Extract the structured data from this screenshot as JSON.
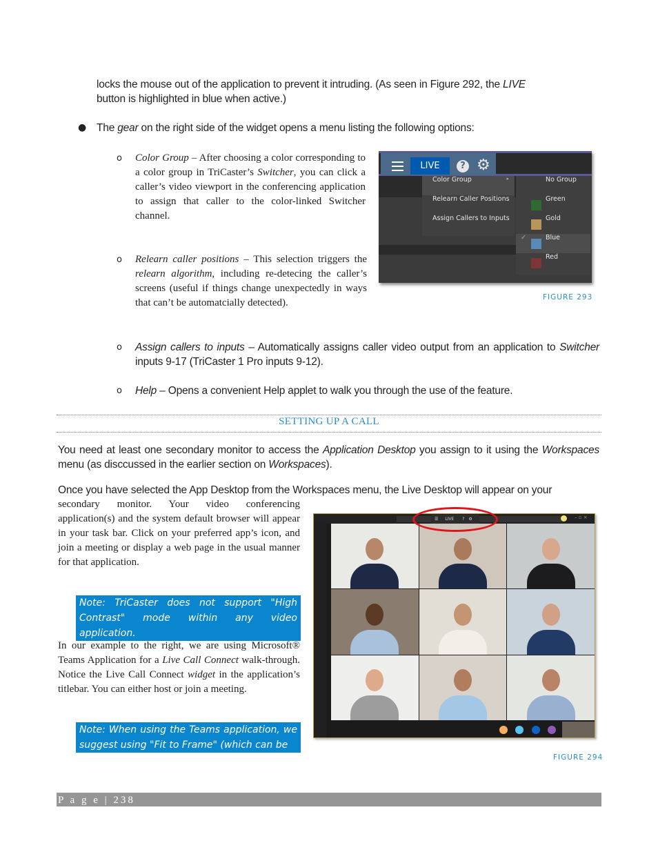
{
  "intro": {
    "line1": "locks the mouse out of the application to prevent it intruding.  (As seen in Figure 292, the ",
    "live_word": "LIVE",
    "line2": "button is highlighted in blue when active.)"
  },
  "gear_bullet": {
    "prefix": "The ",
    "gear_word": "gear",
    "rest": " on the right side of the widget opens a menu listing the following options:"
  },
  "options": [
    {
      "term": "Color Group",
      "text_a": " – After choosing a color corresponding to a color group in TriCaster’s ",
      "switcher": "Switcher",
      "text_b": ", you can click a caller’s video viewport in the conferencing application to assign that caller to the color-linked Switcher channel."
    },
    {
      "term": "Relearn caller positions",
      "text_a": " – This selection triggers the ",
      "algo": "relearn algorithm",
      "text_b": ", including re-detecing the caller’s screens (useful if things change unexpectedly in ways that can’t be automatcially detected)."
    },
    {
      "term": "Assign callers to inputs",
      "text_a": " – Automatically assigns caller video output from an application to ",
      "switcher": "Switcher",
      "text_b": " inputs 9-17 (TriCaster 1 Pro inputs 9-12)."
    },
    {
      "term": "Help",
      "text_a": " – Opens a convenient Help applet to walk you through the use of the feature."
    }
  ],
  "figure293": {
    "caption": "FIGURE 293",
    "live_label": "LIVE",
    "help_glyph": "?",
    "gear_glyph": "⚙",
    "menu_items": [
      "Color Group",
      "Relearn Caller Positions",
      "Assign Callers to Inputs"
    ],
    "submenu_arrow": "▸",
    "color_groups": [
      {
        "label": "No Group",
        "color": null,
        "checked": false
      },
      {
        "label": "Green",
        "color": "#2f6b30",
        "checked": false
      },
      {
        "label": "Gold",
        "color": "#b8965a",
        "checked": false
      },
      {
        "label": "Blue",
        "color": "#5a8ab8",
        "checked": true
      },
      {
        "label": "Red",
        "color": "#7d3535",
        "checked": false
      }
    ],
    "check_glyph": "✓"
  },
  "section": {
    "title": "SETTING UP A CALL"
  },
  "para1": {
    "a": "You need at least one secondary monitor to access the ",
    "app_desktop": "Application Desktop",
    "b": " you assign to it using the ",
    "workspaces": "Workspaces",
    "c": "  menu (as disccussed in the earlier section on ",
    "workspaces2": "Workspaces",
    "d": ")."
  },
  "para2": {
    "full_line": "Once you have selected the App Desktop from the Workspaces menu, the Live Desktop will appear on your",
    "rest": "secondary monitor.  Your video conferencing application(s) and the system default browser will appear in your task bar.  Click on your preferred app’s icon, and join a meeting or display a web page in the usual manner for that application."
  },
  "note1": "Note:  TriCaster does not support \"High Contrast\" mode within any video application.",
  "para3": {
    "a": "In our example to the right, we are using Microsoft® Teams Application for a ",
    "lcc": "Live Call Connect",
    "b": " walk-through.  Notice the Live Call Connect ",
    "widget": "widget",
    "c": " in the application’s titlebar.  You can either host or join a meeting."
  },
  "note2": "Note:  When using the Teams application, we suggest using \"Fit to Frame\" (which can be",
  "figure294": {
    "caption": "FIGURE 294",
    "widget_live": "LIVE",
    "widget_menu_glyph": "☰",
    "widget_help_glyph": "?",
    "widget_gear_glyph": "⚙",
    "reaction_colors": [
      "#f7ae63",
      "#59c4f0",
      "#0d63c7",
      "#8d5bb5"
    ],
    "participants": 9
  },
  "footer": {
    "page_label": "P a g e  |  238"
  }
}
